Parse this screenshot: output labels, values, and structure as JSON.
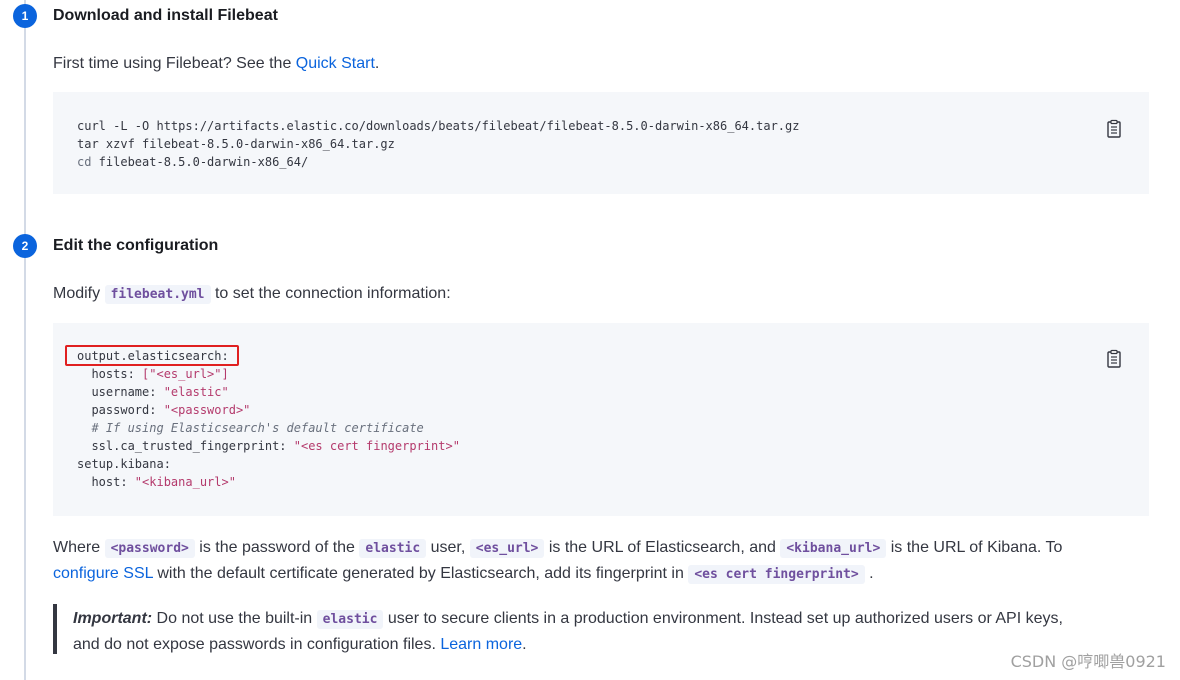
{
  "step1": {
    "number": "1",
    "title": "Download and install Filebeat",
    "intro_prefix": "First time using Filebeat? See the ",
    "intro_link": "Quick Start",
    "intro_suffix": ".",
    "code_lines": [
      "curl -L -O https://artifacts.elastic.co/downloads/beats/filebeat/filebeat-8.5.0-darwin-x86_64.tar.gz",
      "tar xzvf filebeat-8.5.0-darwin-x86_64.tar.gz",
      "cd filebeat-8.5.0-darwin-x86_64/"
    ],
    "cd_keyword": "cd",
    "cd_rest": " filebeat-8.5.0-darwin-x86_64/"
  },
  "step2": {
    "number": "2",
    "title": "Edit the configuration",
    "intro_prefix": "Modify ",
    "intro_code": "filebeat.yml",
    "intro_suffix": " to set the connection information:",
    "config": {
      "l1": "output.elasticsearch:",
      "l2_key": "  hosts: ",
      "l2_val": "[\"<es_url>\"]",
      "l3_key": "  username: ",
      "l3_val": "\"elastic\"",
      "l4_key": "  password: ",
      "l4_val": "\"<password>\"",
      "l5": "  # If using Elasticsearch's default certificate",
      "l6_key": "  ssl.ca_trusted_fingerprint: ",
      "l6_val": "\"<es cert fingerprint>\"",
      "l7": "setup.kibana:",
      "l8_key": "  host: ",
      "l8_val": "\"<kibana_url>\""
    },
    "where": {
      "t1": "Where ",
      "c1": "<password>",
      "t2": " is the password of the ",
      "c2": "elastic",
      "t3": " user, ",
      "c3": "<es_url>",
      "t4": " is the URL of Elasticsearch, and ",
      "c4": "<kibana_url>",
      "t5": " is the URL of Kibana. To",
      "link": "configure SSL",
      "t6": " with the default certificate generated by Elasticsearch, add its fingerprint in ",
      "c5": "<es cert fingerprint>",
      "t7": " ."
    },
    "important": {
      "label": "Important:",
      "t1": " Do not use the built-in ",
      "code": "elastic",
      "t2": " user to secure clients in a production environment. Instead set up authorized users or API keys,",
      "t3": "and do not expose passwords in configuration files. ",
      "link": "Learn more",
      "t4": "."
    }
  },
  "watermark": "CSDN @哼唧兽0921",
  "colors": {
    "step_badge": "#0b64dd",
    "link": "#0b64dd",
    "code_bg": "#f5f7fa",
    "highlight_box": "#e02020",
    "string": "#b43a6c",
    "inline_code": "#6f4f9e"
  }
}
